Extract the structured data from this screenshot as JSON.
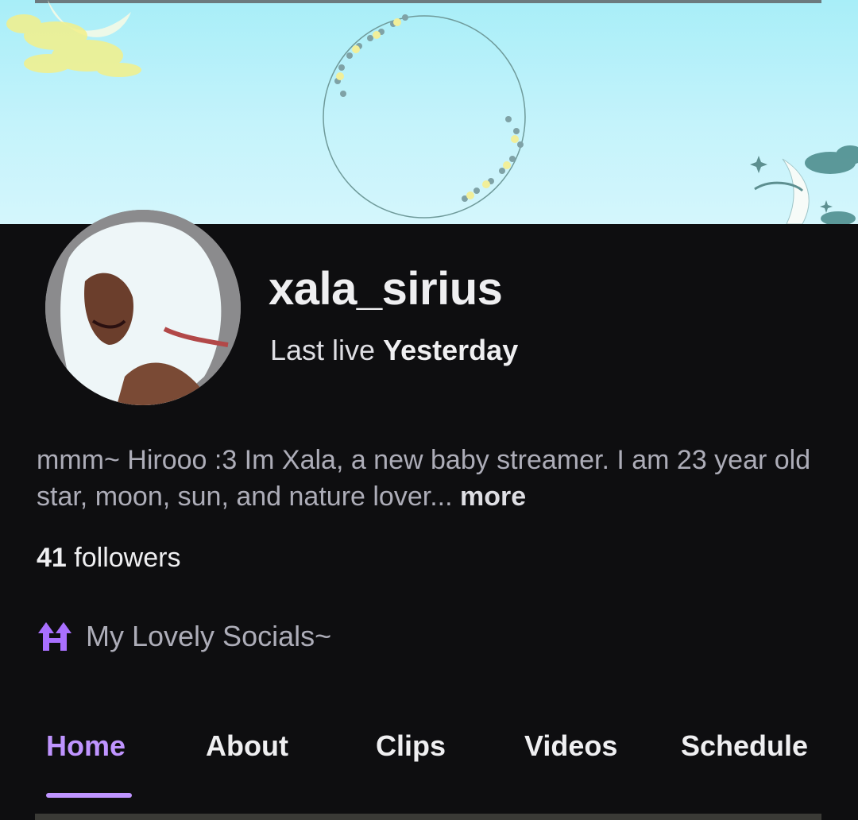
{
  "channel": {
    "username": "xala_sirius",
    "last_live_label": "Last live",
    "last_live_value": "Yesterday",
    "bio": "mmm~ Hirooo :3 Im Xala, a new baby streamer. I am 23 year old star, moon, sun, and nature lover...",
    "bio_more": "more",
    "followers_count": "41",
    "followers_label": "followers",
    "socials_label": "My Lovely Socials~",
    "socials_icon": "linktree-icon"
  },
  "tabs": [
    {
      "label": "Home",
      "active": true
    },
    {
      "label": "About",
      "active": false
    },
    {
      "label": "Clips",
      "active": false
    },
    {
      "label": "Videos",
      "active": false
    },
    {
      "label": "Schedule",
      "active": false
    }
  ],
  "colors": {
    "accent": "#bf94ff",
    "background": "#0e0e10",
    "banner": "#b8f0fa"
  }
}
